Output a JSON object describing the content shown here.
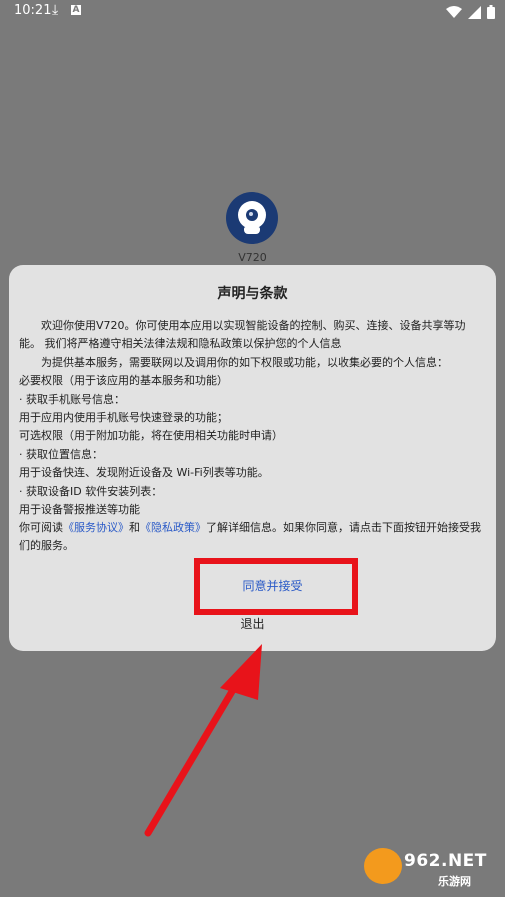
{
  "status_bar": {
    "time": "10:21",
    "download_icon": "download-icon",
    "notification_letter": "A"
  },
  "app": {
    "name": "V720"
  },
  "dialog": {
    "title": "声明与条款",
    "lines": [
      "欢迎你使用V720。你可使用本应用以实现智能设备的控制、购买、连接、设备共享等功能。 我们将严格遵守相关法律法规和隐私政策以保护您的个人信息",
      "为提供基本服务，需要联网以及调用你的如下权限或功能，以收集必要的个人信息：",
      "必要权限（用于该应用的基本服务和功能）",
      "· 获取手机账号信息：",
      "用于应用内使用手机账号快速登录的功能；",
      "可选权限（用于附加功能，将在使用相关功能时申请）",
      "· 获取位置信息：",
      "用于设备快连、发现附近设备及 Wi-Fi列表等功能。",
      "· 获取设备ID 软件安装列表：",
      "用于设备警报推送等功能"
    ],
    "footer_prefix": "你可阅读",
    "link_service": "《服务协议》",
    "footer_and": "和",
    "link_privacy": "《隐私政策》",
    "footer_suffix": "了解详细信息。如果你同意，请点击下面按钮开始接受我们的服务。",
    "agree_label": "同意并接受",
    "exit_label": "退出"
  },
  "watermark": {
    "main": "962.NET",
    "sub": "乐游网"
  },
  "colors": {
    "overlay": "#7a7a7a",
    "dialog_bg": "#e2e2e2",
    "link": "#2a5ac7",
    "highlight": "#e8131a"
  }
}
